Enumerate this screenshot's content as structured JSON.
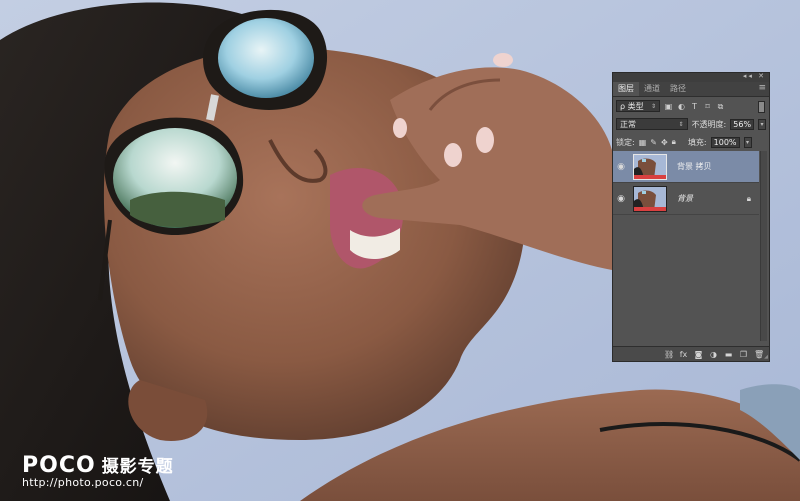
{
  "panel": {
    "topbar_icons": "◂◂ ✕",
    "tabs": [
      {
        "label": "图层"
      },
      {
        "label": "通道"
      },
      {
        "label": "路径"
      }
    ],
    "menu_icon": "≡",
    "filter": {
      "kind_label": "ρ 类型"
    },
    "blend": {
      "mode": "正常"
    },
    "opacity": {
      "label": "不透明度:",
      "value": "56%"
    },
    "lock": {
      "label": "锁定:"
    },
    "fill": {
      "label": "填充:",
      "value": "100%"
    },
    "layers": [
      {
        "name": "背景 拷贝",
        "selected": true
      },
      {
        "name": "背景",
        "locked": true
      }
    ]
  },
  "watermark": {
    "logo": "POCO",
    "subtitle": "摄影专题",
    "url": "http://photo.poco.cn/"
  },
  "colors": {
    "panel_bg": "#535353",
    "selected_layer": "#7b8ba7",
    "sky": "#b9c6de",
    "skin": "#8f5d45"
  }
}
